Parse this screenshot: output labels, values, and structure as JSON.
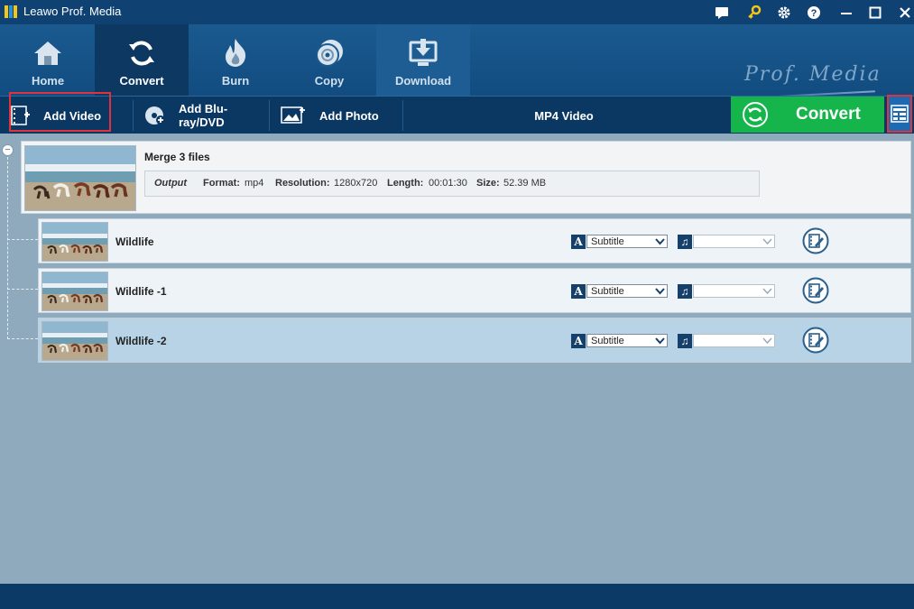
{
  "window": {
    "title": "Leawo Prof. Media",
    "icons": [
      "chat-icon",
      "key-icon",
      "gear-icon",
      "help-icon",
      "minimize-icon",
      "maximize-icon",
      "close-icon"
    ]
  },
  "nav": {
    "items": [
      {
        "label": "Home",
        "icon": "home-icon"
      },
      {
        "label": "Convert",
        "icon": "convert-icon",
        "active": true
      },
      {
        "label": "Burn",
        "icon": "burn-icon"
      },
      {
        "label": "Copy",
        "icon": "copy-icon"
      },
      {
        "label": "Download",
        "icon": "download-icon"
      }
    ],
    "brand": "Prof. Media"
  },
  "toolbar": {
    "add_video": "Add Video",
    "add_bluray": "Add Blu-ray/DVD",
    "add_photo": "Add Photo",
    "profile": "MP4 Video",
    "convert": "Convert",
    "accent": "#15b54b"
  },
  "merge": {
    "title": "Merge 3 files",
    "output_label": "Output",
    "format_label": "Format:",
    "format": "mp4",
    "resolution_label": "Resolution:",
    "resolution": "1280x720",
    "length_label": "Length:",
    "length": "00:01:30",
    "size_label": "Size:",
    "size": "52.39 MB"
  },
  "files": [
    {
      "name": "Wildlife",
      "subtitle": "Subtitle",
      "audio": ""
    },
    {
      "name": "Wildlife -1",
      "subtitle": "Subtitle",
      "audio": ""
    },
    {
      "name": "Wildlife -2",
      "subtitle": "Subtitle",
      "audio": "",
      "selected": true
    }
  ]
}
